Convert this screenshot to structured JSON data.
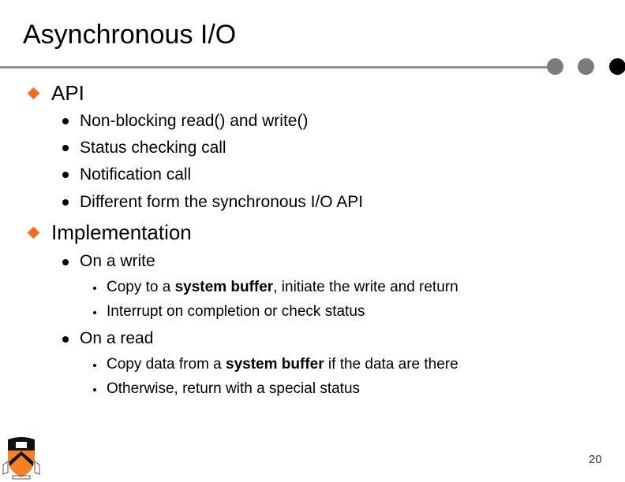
{
  "slide": {
    "title": "Asynchronous I/O",
    "page_number": "20",
    "accent_color": "#f26d21",
    "sections": [
      {
        "label": "API",
        "items": [
          {
            "label": "Non-blocking read() and write()"
          },
          {
            "label": "Status checking call"
          },
          {
            "label": "Notification call"
          },
          {
            "label": "Different form the synchronous I/O API"
          }
        ]
      },
      {
        "label": "Implementation",
        "items": [
          {
            "label": "On a write",
            "subitems": [
              {
                "pre": "Copy to a ",
                "bold": "system buffer",
                "post": ", initiate the write and return"
              },
              {
                "pre": "Interrupt on completion or check status",
                "bold": "",
                "post": ""
              }
            ]
          },
          {
            "label": "On a read",
            "subitems": [
              {
                "pre": "Copy data from a ",
                "bold": "system buffer",
                "post": " if the data are there"
              },
              {
                "pre": "Otherwise, return with a special status",
                "bold": "",
                "post": ""
              }
            ]
          }
        ]
      }
    ],
    "logo": "princeton-shield-logo"
  }
}
